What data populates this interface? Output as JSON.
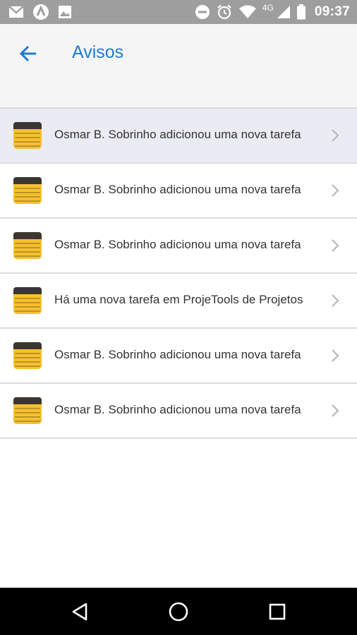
{
  "status_bar": {
    "time": "09:37",
    "network": "4G",
    "left_icons": [
      "gmail-icon",
      "app-icon",
      "image-icon"
    ],
    "right_icons": [
      "do-not-disturb-icon",
      "alarm-icon",
      "wifi-icon",
      "signal-icon",
      "battery-icon"
    ]
  },
  "appbar": {
    "title": "Avisos",
    "back_icon": "arrow-left-icon"
  },
  "notifications": [
    {
      "text": "Osmar B. Sobrinho adicionou uma nova tarefa",
      "selected": true
    },
    {
      "text": "Osmar B. Sobrinho adicionou uma nova tarefa",
      "selected": false
    },
    {
      "text": "Osmar B. Sobrinho adicionou uma nova tarefa",
      "selected": false
    },
    {
      "text": "Há uma nova tarefa em ProjeTools  de Projetos",
      "selected": false
    },
    {
      "text": "Osmar B. Sobrinho adicionou uma nova tarefa",
      "selected": false
    },
    {
      "text": "Osmar B. Sobrinho adicionou uma nova tarefa",
      "selected": false
    }
  ],
  "nav_bar": {
    "buttons": [
      "back-triangle-icon",
      "home-circle-icon",
      "recents-square-icon"
    ]
  },
  "colors": {
    "accent": "#1e7bd1",
    "status_bar": "#9e9e9e",
    "appbar_bg": "#f5f5f5",
    "selected_row": "#ebebf3",
    "note_icon_yellow": "#f6c02f",
    "note_icon_dark": "#3a3632"
  }
}
